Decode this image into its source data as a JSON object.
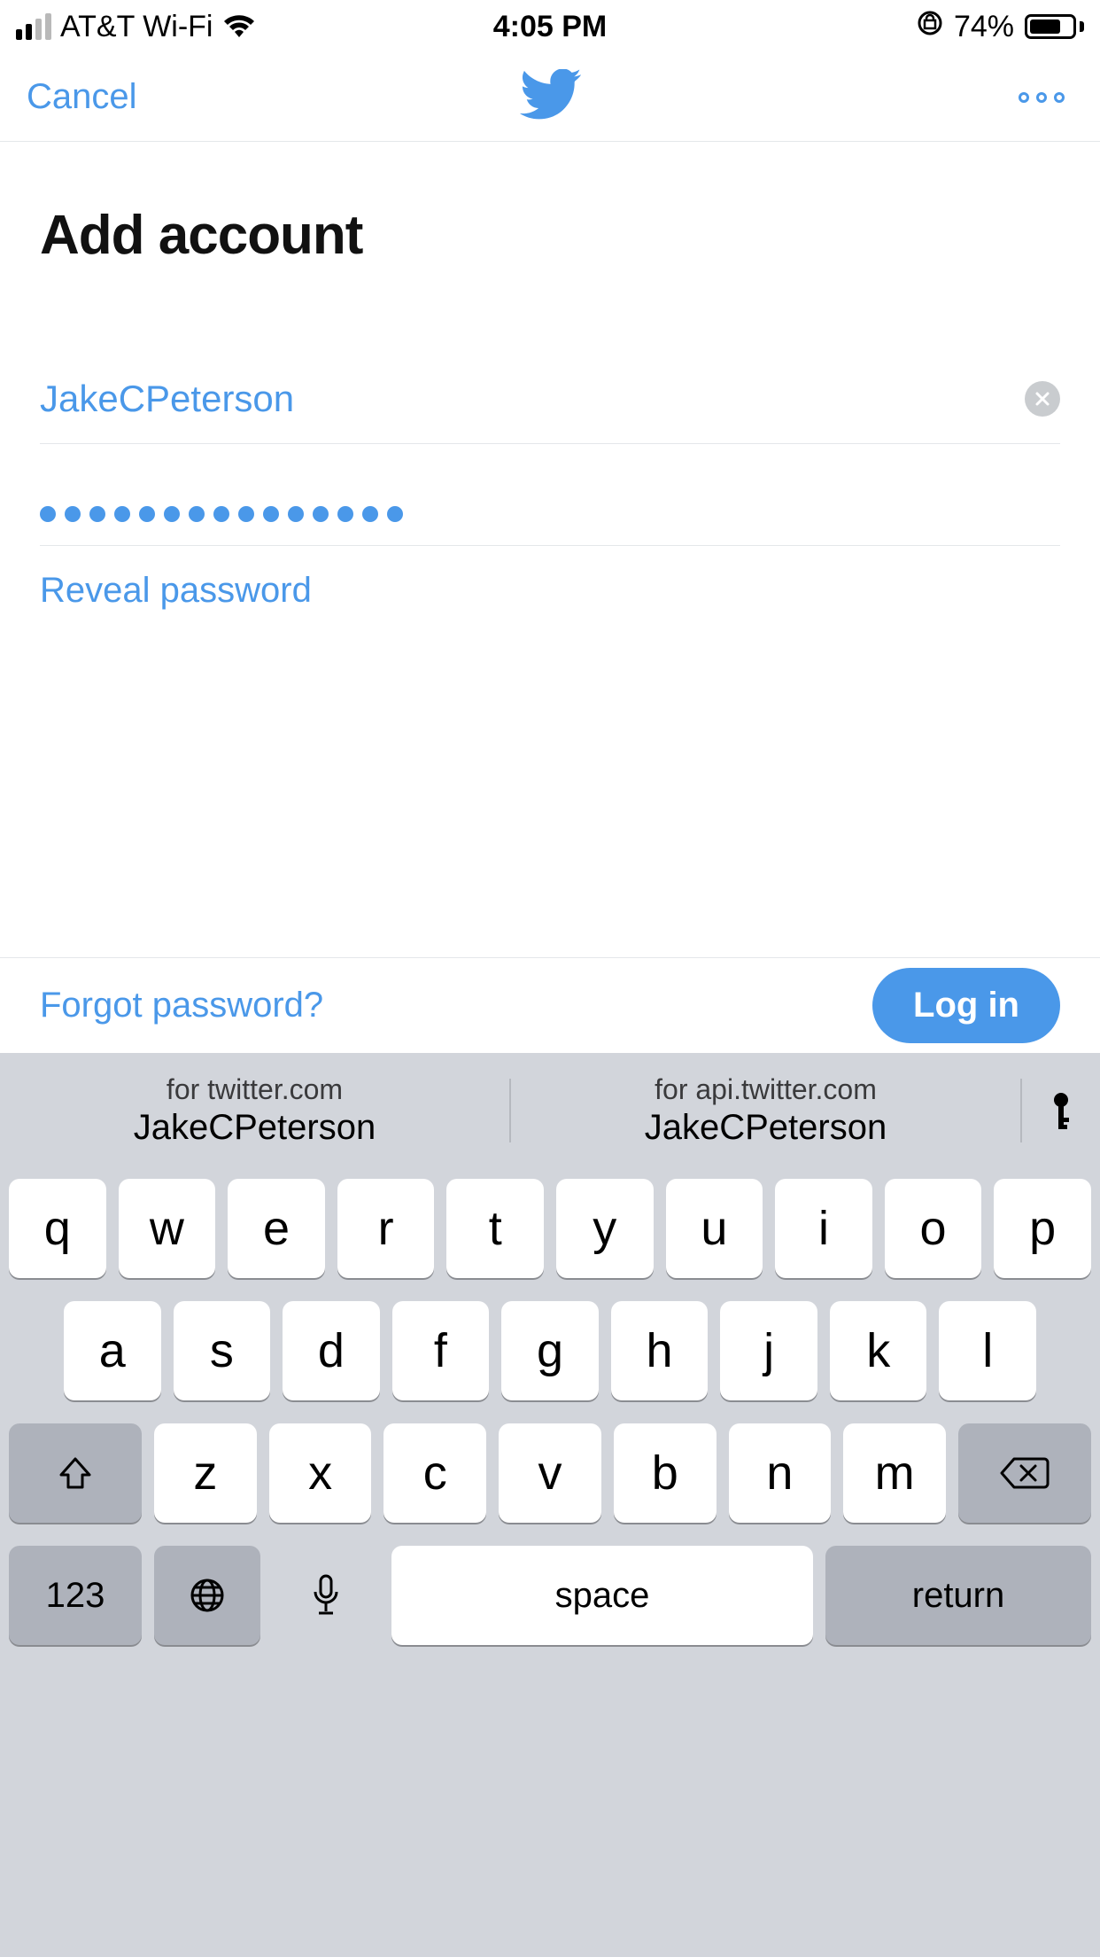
{
  "status": {
    "carrier": "AT&T Wi-Fi",
    "time": "4:05 PM",
    "battery_pct": "74%",
    "battery_fill": 74
  },
  "nav": {
    "cancel": "Cancel"
  },
  "page": {
    "title": "Add account"
  },
  "form": {
    "username": "JakeCPeterson",
    "password_dots": 15,
    "reveal_label": "Reveal password"
  },
  "actions": {
    "forgot": "Forgot password?",
    "login": "Log in"
  },
  "suggest": {
    "left_top": "for twitter.com",
    "left_bot": "JakeCPeterson",
    "right_top": "for api.twitter.com",
    "right_bot": "JakeCPeterson"
  },
  "keyboard": {
    "row1": [
      "q",
      "w",
      "e",
      "r",
      "t",
      "y",
      "u",
      "i",
      "o",
      "p"
    ],
    "row2": [
      "a",
      "s",
      "d",
      "f",
      "g",
      "h",
      "j",
      "k",
      "l"
    ],
    "row3": [
      "z",
      "x",
      "c",
      "v",
      "b",
      "n",
      "m"
    ],
    "numeric": "123",
    "space": "space",
    "return": "return"
  }
}
